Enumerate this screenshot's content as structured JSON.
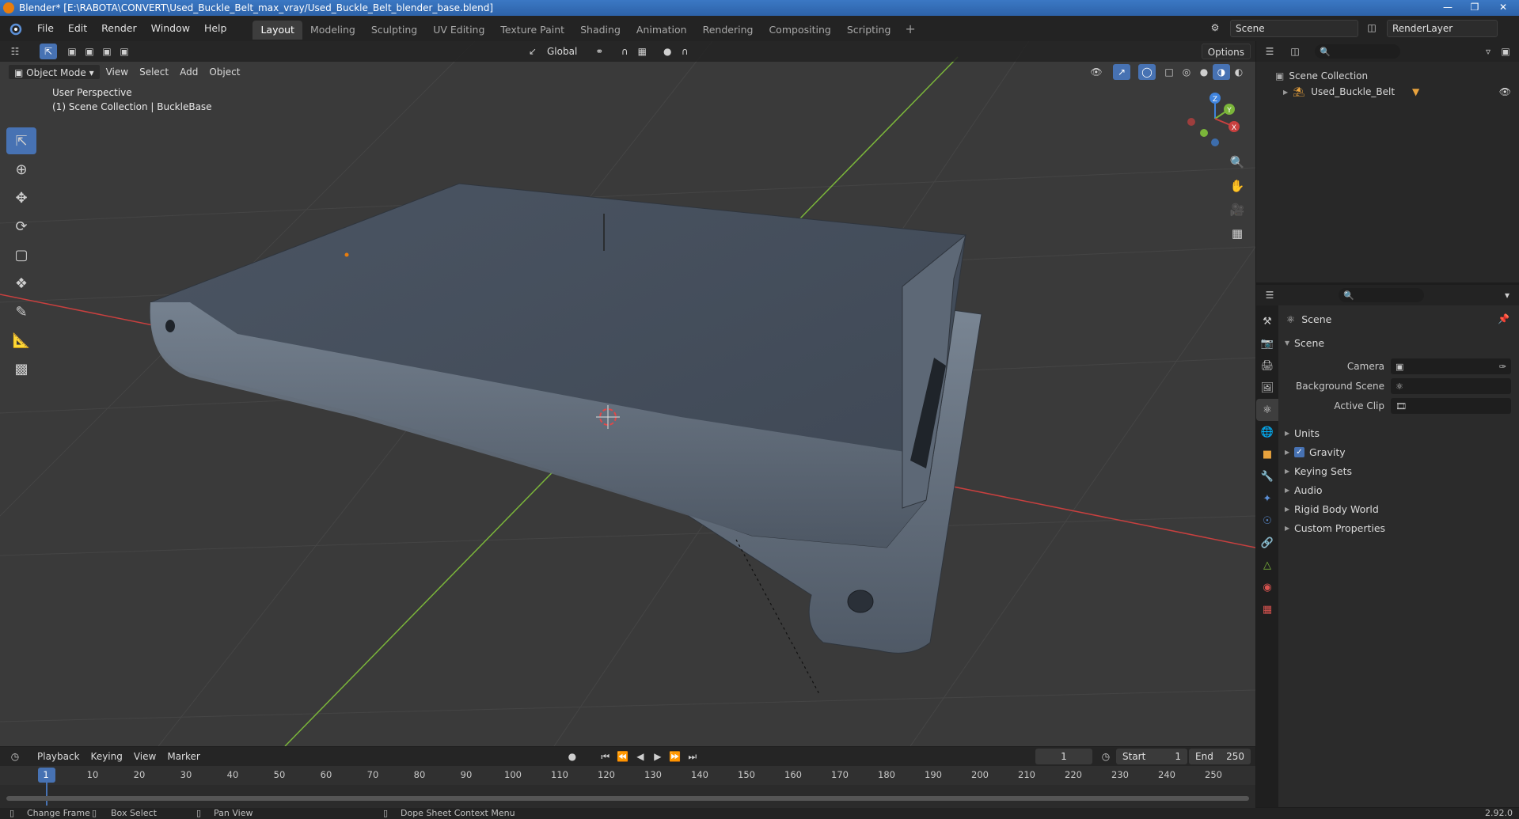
{
  "window": {
    "title": "Blender* [E:\\RABOTA\\CONVERT\\Used_Buckle_Belt_max_vray/Used_Buckle_Belt_blender_base.blend]"
  },
  "menus": [
    "File",
    "Edit",
    "Render",
    "Window",
    "Help"
  ],
  "workspaces": [
    {
      "label": "Layout",
      "active": true
    },
    {
      "label": "Modeling"
    },
    {
      "label": "Sculpting"
    },
    {
      "label": "UV Editing"
    },
    {
      "label": "Texture Paint"
    },
    {
      "label": "Shading"
    },
    {
      "label": "Animation"
    },
    {
      "label": "Rendering"
    },
    {
      "label": "Compositing"
    },
    {
      "label": "Scripting"
    }
  ],
  "scene_selector": {
    "value": "Scene"
  },
  "view_layer_selector": {
    "value": "RenderLayer"
  },
  "viewport": {
    "mode": "Object Mode",
    "menus": [
      "View",
      "Select",
      "Add",
      "Object"
    ],
    "transform_orientation": "Global",
    "options_label": "Options",
    "info_line1": "User Perspective",
    "info_line2": "(1) Scene Collection | BuckleBase",
    "gizmo": {
      "x": "X",
      "y": "Y",
      "z": "Z"
    }
  },
  "outliner": {
    "root": "Scene Collection",
    "items": [
      {
        "label": "Used_Buckle_Belt"
      }
    ]
  },
  "properties": {
    "context_title": "Scene",
    "panel_title": "Scene",
    "fields": [
      {
        "label": "Camera",
        "value": ""
      },
      {
        "label": "Background Scene",
        "value": ""
      },
      {
        "label": "Active Clip",
        "value": ""
      }
    ],
    "subpanels": [
      {
        "label": "Units"
      },
      {
        "label": "Gravity",
        "checked": true
      },
      {
        "label": "Keying Sets"
      },
      {
        "label": "Audio"
      },
      {
        "label": "Rigid Body World"
      },
      {
        "label": "Custom Properties"
      }
    ]
  },
  "timeline": {
    "menus": [
      "Playback",
      "Keying",
      "View",
      "Marker"
    ],
    "current_frame": "1",
    "start_label": "Start",
    "start": "1",
    "end_label": "End",
    "end": "250",
    "ruler": [
      "1",
      "10",
      "20",
      "30",
      "40",
      "50",
      "60",
      "70",
      "80",
      "90",
      "100",
      "110",
      "120",
      "130",
      "140",
      "150",
      "160",
      "170",
      "180",
      "190",
      "200",
      "210",
      "220",
      "230",
      "240",
      "250"
    ]
  },
  "statusbar": {
    "hints": [
      "Change Frame",
      "Box Select",
      "Pan View",
      "Dope Sheet Context Menu"
    ],
    "version": "2.92.0"
  },
  "colors": {
    "accent": "#4772b3",
    "x_axis": "#c8403f",
    "y_axis": "#7bb63a",
    "z_axis": "#3f83dd",
    "origin": "#e87d0d"
  }
}
